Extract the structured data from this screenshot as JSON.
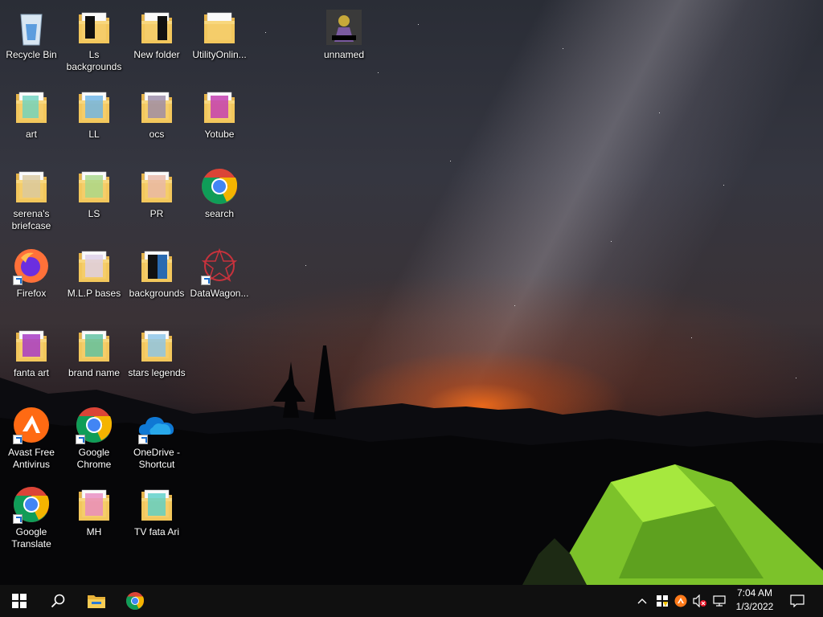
{
  "desktop": {
    "icons": [
      {
        "label": "Recycle Bin",
        "icon": "recycle-bin-icon"
      },
      {
        "label": "Ls backgrounds",
        "icon": "folder-icon"
      },
      {
        "label": "New folder",
        "icon": "folder-icon"
      },
      {
        "label": "UtilityOnlin...",
        "icon": "file-icon"
      },
      {
        "label": "unnamed",
        "icon": "image-icon"
      },
      {
        "label": "art",
        "icon": "folder-icon"
      },
      {
        "label": "LL",
        "icon": "folder-icon"
      },
      {
        "label": "ocs",
        "icon": "folder-icon"
      },
      {
        "label": "Yotube",
        "icon": "folder-icon"
      },
      {
        "label": "serena's briefcase",
        "icon": "folder-icon"
      },
      {
        "label": "LS",
        "icon": "folder-icon"
      },
      {
        "label": "PR",
        "icon": "folder-icon"
      },
      {
        "label": "search",
        "icon": "chrome-icon"
      },
      {
        "label": "Firefox",
        "icon": "firefox-icon"
      },
      {
        "label": "M.L.P bases",
        "icon": "folder-icon"
      },
      {
        "label": "backgrounds",
        "icon": "folder-icon"
      },
      {
        "label": "DataWagon...",
        "icon": "datawagon-icon"
      },
      {
        "label": "fanta art",
        "icon": "folder-icon"
      },
      {
        "label": "brand name",
        "icon": "folder-icon"
      },
      {
        "label": "stars legends",
        "icon": "folder-icon"
      },
      {
        "label": "Avast Free Antivirus",
        "icon": "avast-icon"
      },
      {
        "label": "Google Chrome",
        "icon": "chrome-icon"
      },
      {
        "label": "OneDrive - Shortcut",
        "icon": "onedrive-icon"
      },
      {
        "label": "Google Translate",
        "icon": "chrome-icon"
      },
      {
        "label": "MH",
        "icon": "folder-icon"
      },
      {
        "label": "TV fata Ari",
        "icon": "folder-icon"
      }
    ]
  },
  "taskbar": {
    "start": "windows-start-icon",
    "search": "search-icon",
    "pinned": [
      "file-explorer-icon",
      "chrome-icon"
    ],
    "tray": [
      "chevron-up-icon",
      "windows-security-icon",
      "avast-tray-icon",
      "volume-muted-icon",
      "network-icon"
    ],
    "clock": {
      "time": "7:04 AM",
      "date": "1/3/2022"
    },
    "notifications": "action-center-icon"
  },
  "colors": {
    "taskbar": "#101010",
    "folder": "#f4c95d",
    "tent": "#8cd62e",
    "glow": "#ff6e14"
  }
}
